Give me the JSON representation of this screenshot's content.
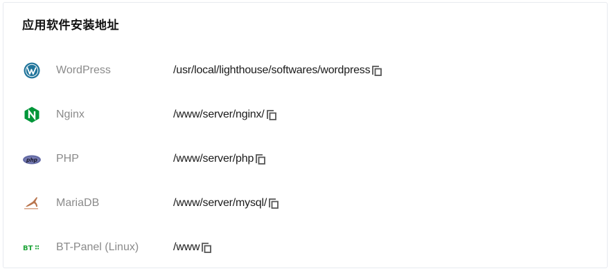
{
  "panel": {
    "title": "应用软件安装地址"
  },
  "apps": [
    {
      "icon": "wordpress-logo-icon",
      "name": "WordPress",
      "path": "/usr/local/lighthouse/softwares/wordpress"
    },
    {
      "icon": "nginx-logo-icon",
      "name": "Nginx",
      "path": "/www/server/nginx/"
    },
    {
      "icon": "php-logo-icon",
      "name": "PHP",
      "path": "/www/server/php"
    },
    {
      "icon": "mariadb-logo-icon",
      "name": "MariaDB",
      "path": "/www/server/mysql/"
    },
    {
      "icon": "bt-panel-logo-icon",
      "name": "BT-Panel (Linux)",
      "path": "/www"
    }
  ],
  "colors": {
    "wordpress": "#21759b",
    "nginx": "#009639",
    "php": "#777bb3",
    "mariadb": "#c0765a",
    "bt_panel": "#20a53a"
  }
}
